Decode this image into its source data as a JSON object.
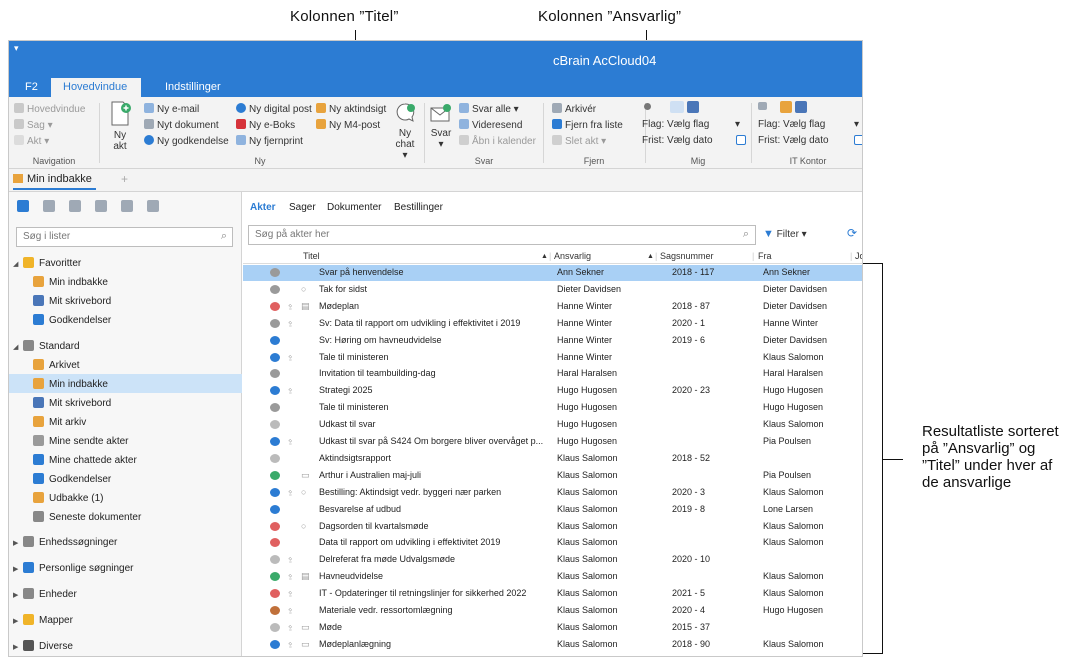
{
  "annotations": {
    "titel_label": "Kolonnen ”Titel”",
    "ansvarlig_label": "Kolonnen ”Ansvarlig”",
    "result_note": "Resultatliste sorteret på ”Ansvarlig” og ”Titel” under hver af de ansvarlige"
  },
  "app": {
    "title": "cBrain AcCloud04",
    "qa_toolbar": "▾",
    "ribbon_tabs": [
      "F2",
      "Hovedvindue",
      "Indstillinger"
    ],
    "active_tab": "Hovedvindue"
  },
  "ribbon": {
    "navigation": {
      "items": [
        "Hovedvindue",
        "Sag ▾",
        "Akt ▾"
      ],
      "label": "Navigation"
    },
    "ny": {
      "big_button": "Ny akt",
      "items": [
        "Ny e-mail",
        "Nyt dokument",
        "Ny godkendelse",
        "Ny digital post",
        "Ny e-Boks",
        "Ny fjernprint",
        "Ny aktindsigt",
        "Ny M4-post"
      ],
      "chat_button": "Ny chat ▾",
      "label": "Ny"
    },
    "svar": {
      "big_button": "Svar ▾",
      "items": [
        "Svar alle ▾",
        "Videresend",
        "Åbn i kalender"
      ],
      "label": "Svar"
    },
    "fjern": {
      "items": [
        "Arkivér",
        "Fjern fra liste",
        "Slet akt ▾"
      ],
      "label": "Fjern"
    },
    "mig": {
      "flag_label": "Flag:",
      "flag_value": "Vælg flag",
      "frist_label": "Frist:",
      "frist_value": "Vælg dato",
      "label": "Mig"
    },
    "itkontor": {
      "flag_label": "Flag:",
      "flag_value": "Vælg flag",
      "frist_label": "Frist:",
      "frist_value": "Vælg dato",
      "label": "IT Kontor"
    }
  },
  "doc_tab": {
    "label": "Min indbakke",
    "add": "+"
  },
  "left": {
    "search_placeholder": "Søg i lister",
    "tree": [
      {
        "label": "Favoritter",
        "level": 0,
        "expander": "◢",
        "icon_color": "#f0b429"
      },
      {
        "label": "Min indbakke",
        "level": 1,
        "icon_color": "#e8a33d"
      },
      {
        "label": "Mit skrivebord",
        "level": 1,
        "icon_color": "#4a76b8"
      },
      {
        "label": "Godkendelser",
        "level": 1,
        "icon_color": "#2c7cd3"
      },
      {
        "label": "Standard",
        "level": 0,
        "expander": "◢",
        "icon_color": "#888888"
      },
      {
        "label": "Arkivet",
        "level": 1,
        "icon_color": "#e8a33d"
      },
      {
        "label": "Min indbakke",
        "level": 1,
        "icon_color": "#e8a33d",
        "selected": true
      },
      {
        "label": "Mit skrivebord",
        "level": 1,
        "icon_color": "#4a76b8"
      },
      {
        "label": "Mit arkiv",
        "level": 1,
        "icon_color": "#e8a33d"
      },
      {
        "label": "Mine sendte akter",
        "level": 1,
        "icon_color": "#9a9a9a"
      },
      {
        "label": "Mine chattede akter",
        "level": 1,
        "icon_color": "#2c7cd3"
      },
      {
        "label": "Godkendelser",
        "level": 1,
        "icon_color": "#2c7cd3"
      },
      {
        "label": "Udbakke (1)",
        "level": 1,
        "icon_color": "#e8a33d"
      },
      {
        "label": "Seneste dokumenter",
        "level": 1,
        "icon_color": "#888888"
      },
      {
        "label": "Enhedssøgninger",
        "level": 0,
        "expander": "▶",
        "icon_color": "#888888"
      },
      {
        "label": "Personlige søgninger",
        "level": 0,
        "expander": "▶",
        "icon_color": "#2c7cd3"
      },
      {
        "label": "Enheder",
        "level": 0,
        "expander": "▶",
        "icon_color": "#888888"
      },
      {
        "label": "Mapper",
        "level": 0,
        "expander": "▶",
        "icon_color": "#f0b429"
      },
      {
        "label": "Diverse",
        "level": 0,
        "expander": "▶",
        "icon_color": "#555555"
      }
    ]
  },
  "right": {
    "tabs": [
      "Akter",
      "Sager",
      "Dokumenter",
      "Bestillinger"
    ],
    "active_tab": "Akter",
    "search_placeholder": "Søg på akter her",
    "filter_label": "Filter ▾",
    "columns": {
      "titel": "Titel",
      "ansvarlig": "Ansvarlig",
      "sagsnummer": "Sagsnummer",
      "fra": "Fra",
      "more": "Jo"
    },
    "rows": [
      {
        "titel": "Svar på henvendelse",
        "ansvarlig": "Ann Sekner",
        "sagsnummer": "2018 - 117",
        "fra": "Ann Sekner",
        "icon": "#9a9a9a",
        "sel": true
      },
      {
        "titel": "Tak for sidst",
        "ansvarlig": "Dieter Davidsen",
        "sagsnummer": "",
        "fra": "Dieter Davidsen",
        "icon": "#9a9a9a",
        "extra": "○"
      },
      {
        "titel": "Mødeplan",
        "ansvarlig": "Hanne Winter",
        "sagsnummer": "2018 - 87",
        "fra": "Dieter Davidsen",
        "icon": "#e06060",
        "clip": true,
        "extra": "▤"
      },
      {
        "titel": "Sv: Data til rapport om udvikling i effektivitet i 2019",
        "ansvarlig": "Hanne Winter",
        "sagsnummer": "2020 - 1",
        "fra": "Hanne Winter",
        "icon": "#9a9a9a",
        "clip": true
      },
      {
        "titel": "Sv: Høring om havneudvidelse",
        "ansvarlig": "Hanne Winter",
        "sagsnummer": "2019 - 6",
        "fra": "Dieter Davidsen",
        "icon": "#2c7cd3"
      },
      {
        "titel": "Tale til ministeren",
        "ansvarlig": "Hanne Winter",
        "sagsnummer": "",
        "fra": "Klaus Salomon",
        "icon": "#2c7cd3",
        "clip": true
      },
      {
        "titel": "Invitation til teambuilding-dag",
        "ansvarlig": "Haral Haralsen",
        "sagsnummer": "",
        "fra": "Haral Haralsen",
        "icon": "#9a9a9a"
      },
      {
        "titel": "Strategi 2025",
        "ansvarlig": "Hugo Hugosen",
        "sagsnummer": "2020 - 23",
        "fra": "Hugo Hugosen",
        "icon": "#2c7cd3",
        "clip": true
      },
      {
        "titel": "Tale til ministeren",
        "ansvarlig": "Hugo Hugosen",
        "sagsnummer": "",
        "fra": "Hugo Hugosen",
        "icon": "#9a9a9a"
      },
      {
        "titel": "Udkast til svar",
        "ansvarlig": "Hugo Hugosen",
        "sagsnummer": "",
        "fra": "Klaus Salomon",
        "icon": "#bbbbbb"
      },
      {
        "titel": "Udkast til svar på S424 Om borgere bliver overvåget p...",
        "ansvarlig": "Hugo Hugosen",
        "sagsnummer": "",
        "fra": "Pia Poulsen",
        "icon": "#2c7cd3",
        "clip": true
      },
      {
        "titel": "Aktindsigtsrapport",
        "ansvarlig": "Klaus Salomon",
        "sagsnummer": "2018 - 52",
        "fra": "",
        "icon": "#bbbbbb"
      },
      {
        "titel": "Arthur i Australien maj-juli",
        "ansvarlig": "Klaus Salomon",
        "sagsnummer": "",
        "fra": "Pia Poulsen",
        "icon": "#3aaa6a",
        "extra": "▭"
      },
      {
        "titel": "Bestilling: Aktindsigt vedr. byggeri nær parken",
        "ansvarlig": "Klaus Salomon",
        "sagsnummer": "2020 - 3",
        "fra": "Klaus Salomon",
        "icon": "#2c7cd3",
        "clip": true,
        "extra": "○"
      },
      {
        "titel": "Besvarelse af udbud",
        "ansvarlig": "Klaus Salomon",
        "sagsnummer": "2019 - 8",
        "fra": "Lone Larsen",
        "icon": "#2c7cd3"
      },
      {
        "titel": "Dagsorden til kvartalsmøde",
        "ansvarlig": "Klaus Salomon",
        "sagsnummer": "",
        "fra": "Klaus Salomon",
        "icon": "#e06060",
        "extra": "○"
      },
      {
        "titel": "Data til rapport om udvikling i effektivitet 2019",
        "ansvarlig": "Klaus Salomon",
        "sagsnummer": "",
        "fra": "Klaus Salomon",
        "icon": "#e06060"
      },
      {
        "titel": "Delreferat fra møde Udvalgsmøde",
        "ansvarlig": "Klaus Salomon",
        "sagsnummer": "2020 - 10",
        "fra": "",
        "icon": "#bbbbbb",
        "clip": true
      },
      {
        "titel": "Havneudvidelse",
        "ansvarlig": "Klaus Salomon",
        "sagsnummer": "",
        "fra": "Klaus Salomon",
        "icon": "#3aaa6a",
        "clip": true,
        "extra": "▤"
      },
      {
        "titel": "IT - Opdateringer til retningslinjer for sikkerhed 2022",
        "ansvarlig": "Klaus Salomon",
        "sagsnummer": "2021 - 5",
        "fra": "Klaus Salomon",
        "icon": "#e06060",
        "clip": true
      },
      {
        "titel": "Materiale vedr. ressortomlægning",
        "ansvarlig": "Klaus Salomon",
        "sagsnummer": "2020 - 4",
        "fra": "Hugo Hugosen",
        "icon": "#c0703a",
        "clip": true
      },
      {
        "titel": "Møde",
        "ansvarlig": "Klaus Salomon",
        "sagsnummer": "2015 - 37",
        "fra": "",
        "icon": "#bbbbbb",
        "clip": true,
        "extra": "▭"
      },
      {
        "titel": "Mødeplanlægning",
        "ansvarlig": "Klaus Salomon",
        "sagsnummer": "2018 - 90",
        "fra": "Klaus Salomon",
        "icon": "#2c7cd3",
        "clip": true,
        "extra": "▭"
      }
    ]
  }
}
